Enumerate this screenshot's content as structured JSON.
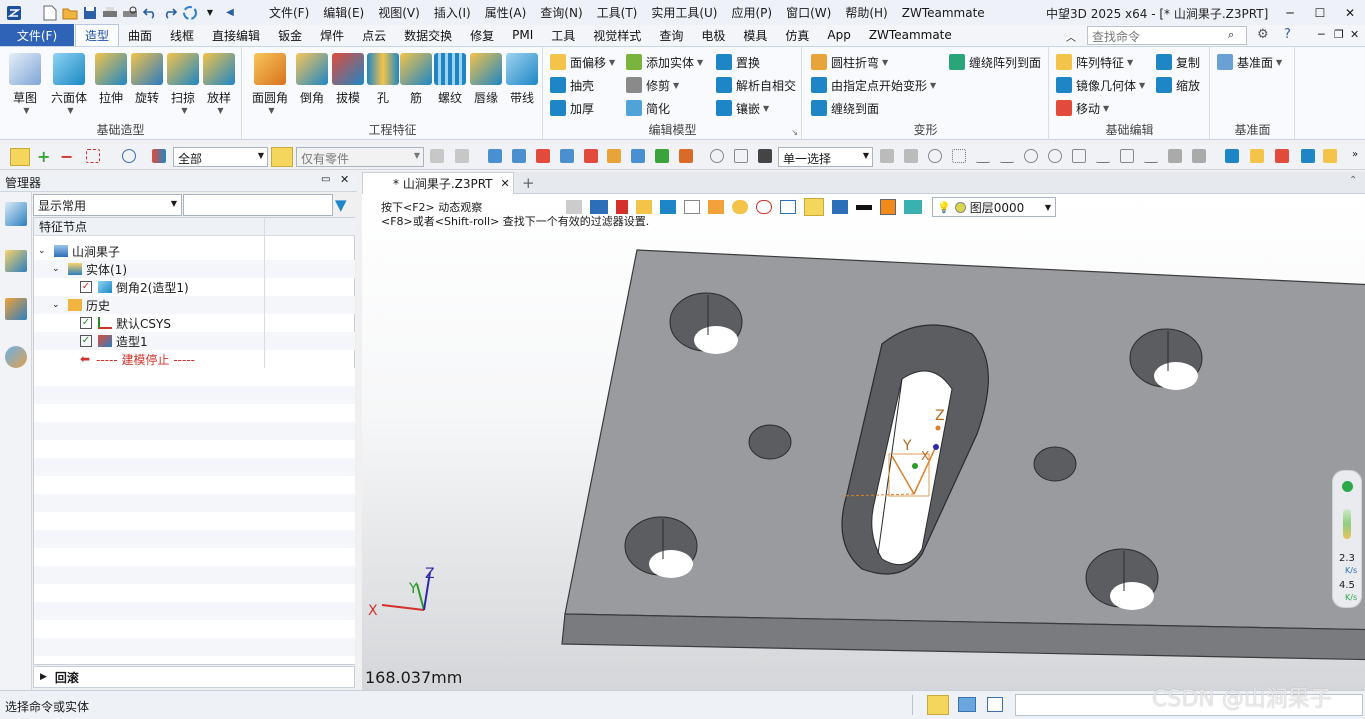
{
  "title_bar": {
    "menus": [
      "文件(F)",
      "编辑(E)",
      "视图(V)",
      "插入(I)",
      "属性(A)",
      "查询(N)",
      "工具(T)",
      "实用工具(U)",
      "应用(P)",
      "窗口(W)",
      "帮助(H)",
      "ZWTeammate"
    ],
    "app_title": "中望3D 2025 x64 - [* 山涧果子.Z3PRT]"
  },
  "tabs": {
    "file": "文件(F)",
    "items": [
      "造型",
      "曲面",
      "线框",
      "直接编辑",
      "钣金",
      "焊件",
      "点云",
      "数据交换",
      "修复",
      "PMI",
      "工具",
      "视觉样式",
      "查询",
      "电极",
      "模具",
      "仿真",
      "App",
      "ZWTeammate"
    ],
    "active": "造型",
    "search_placeholder": "查找命令"
  },
  "ribbon": {
    "basic_modeling": {
      "title": "基础造型",
      "buttons": [
        "草图",
        "六面体",
        "拉伸",
        "旋转",
        "扫掠",
        "放样"
      ]
    },
    "engineering": {
      "title": "工程特征",
      "buttons": [
        "面圆角",
        "倒角",
        "拔模",
        "孔",
        "筋",
        "螺纹",
        "唇缘",
        "带线"
      ]
    },
    "edit_model": {
      "title": "编辑模型",
      "buttons": [
        "面偏移",
        "抽壳",
        "加厚",
        "添加实体",
        "修剪",
        "简化",
        "置换",
        "解析自相交",
        "镶嵌"
      ]
    },
    "deform": {
      "title": "变形",
      "buttons": [
        "圆柱折弯",
        "由指定点开始变形",
        "缠绕到面",
        "缠绕阵列到面"
      ]
    },
    "basic_edit": {
      "title": "基础编辑",
      "buttons": [
        "阵列特征",
        "镜像几何体",
        "移动",
        "复制",
        "缩放"
      ]
    },
    "datum": {
      "title": "基准面",
      "buttons": [
        "基准面"
      ]
    }
  },
  "toolbar2": {
    "filter_all": "全部",
    "parts_only": "仅有零件",
    "select_mode": "单一选择"
  },
  "manager": {
    "title": "管理器",
    "display_mode": "显示常用",
    "column": "特征节点",
    "tree": [
      {
        "label": "山涧果子",
        "level": 0
      },
      {
        "label": "实体(1)",
        "level": 1
      },
      {
        "label": "倒角2(造型1)",
        "level": 2
      },
      {
        "label": "历史",
        "level": 1
      },
      {
        "label": "默认CSYS",
        "level": 2
      },
      {
        "label": "造型1",
        "level": 2
      },
      {
        "label": "----- 建模停止 -----",
        "level": 2
      }
    ],
    "back_panel": "回滚"
  },
  "viewport": {
    "doc_tab": "* 山涧果子.Z3PRT",
    "hint1": "按下<F2> 动态观察",
    "hint2": "<F8>或者<Shift-roll> 查找下一个有效的过滤器设置.",
    "layer": "图层0000",
    "measure": "168.037mm",
    "axis_x": "X",
    "axis_y": "Y",
    "axis_z": "Z",
    "csys_x": "X",
    "csys_y": "Y",
    "csys_z": "Z",
    "speed_up": "2.3",
    "speed_up_unit": "K/s",
    "speed_down": "4.5",
    "speed_down_unit": "K/s"
  },
  "status": {
    "prompt": "选择命令或实体"
  },
  "watermark": "CSDN @山涧果子",
  "colors": {
    "accent": "#2e63b8",
    "part_top": "#9a9b9e",
    "part_front": "#7a7b7e",
    "part_side": "#6c6d70"
  }
}
